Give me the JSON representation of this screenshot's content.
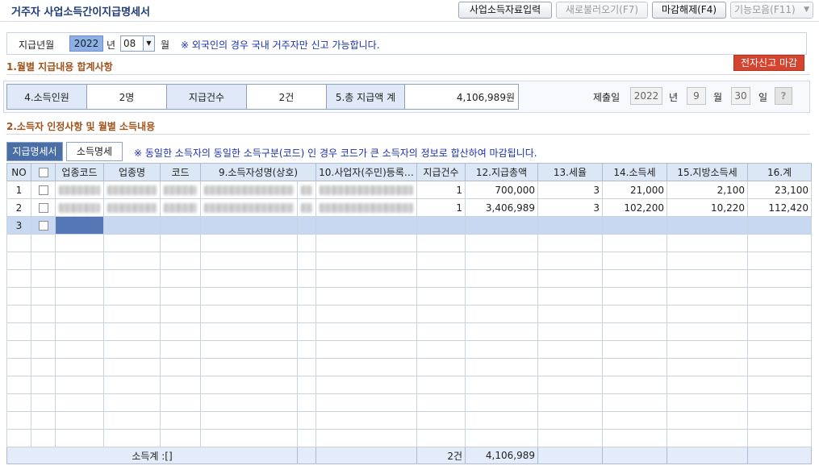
{
  "window": {
    "title": "거주자 사업소득간이지급명세서"
  },
  "toolbar": {
    "import_label": "사업소득자료입력",
    "refresh_label": "새로불러오기(F7)",
    "unclose_label": "마감해제(F4)",
    "functions_label": "기능모음(F11)"
  },
  "period": {
    "label": "지급년월",
    "year": "2022",
    "year_unit": "년",
    "month": "08",
    "month_unit": "월",
    "notice": "※ 외국인의 경우 국내 거주자만 신고 가능합니다."
  },
  "section1": {
    "title": "1.월별 지급내용 합계사항",
    "efile_label": "전자신고 마감"
  },
  "summary": {
    "earners_label": "4.소득인원",
    "earners_value": "2명",
    "count_label": "지급건수",
    "count_value": "2건",
    "total_label": "5.총 지급액 계",
    "total_value": "4,106,989원"
  },
  "submit": {
    "label": "제출일",
    "year": "2022",
    "year_unit": "년",
    "month": "9",
    "month_unit": "월",
    "day": "30",
    "day_unit": "일",
    "help": "?"
  },
  "section2": {
    "title": "2.소득자 인정사항 및 월별 소득내용"
  },
  "tabs": {
    "statement": "지급명세서",
    "details": "소득명세",
    "notice": "※ 동일한 소득자의 동일한 소득구분(코드) 인 경우 코드가 큰 소득자의 정보로 합산하여 마감됩니다."
  },
  "grid": {
    "headers": {
      "no": "NO",
      "biz_code": "업종코드",
      "biz_name": "업종명",
      "code": "코드",
      "name": "9.소득자성명(상호)",
      "resid": "10.사업자(주민)등록…",
      "count": "지급건수",
      "total": "12.지급총액",
      "rate": "13.세율",
      "income_tax": "14.소득세",
      "local_tax": "15.지방소득세",
      "sum": "16.계"
    },
    "rows": [
      {
        "no": "1",
        "count": "1",
        "total": "700,000",
        "rate": "3",
        "income_tax": "21,000",
        "local_tax": "2,100",
        "sum": "23,100"
      },
      {
        "no": "2",
        "count": "1",
        "total": "3,406,989",
        "rate": "3",
        "income_tax": "102,200",
        "local_tax": "10,220",
        "sum": "112,420"
      },
      {
        "no": "3",
        "count": "",
        "total": "",
        "rate": "",
        "income_tax": "",
        "local_tax": "",
        "sum": ""
      }
    ],
    "footer": {
      "label": "소득계 :[]",
      "count": "2건",
      "total": "4,106,989"
    }
  }
}
